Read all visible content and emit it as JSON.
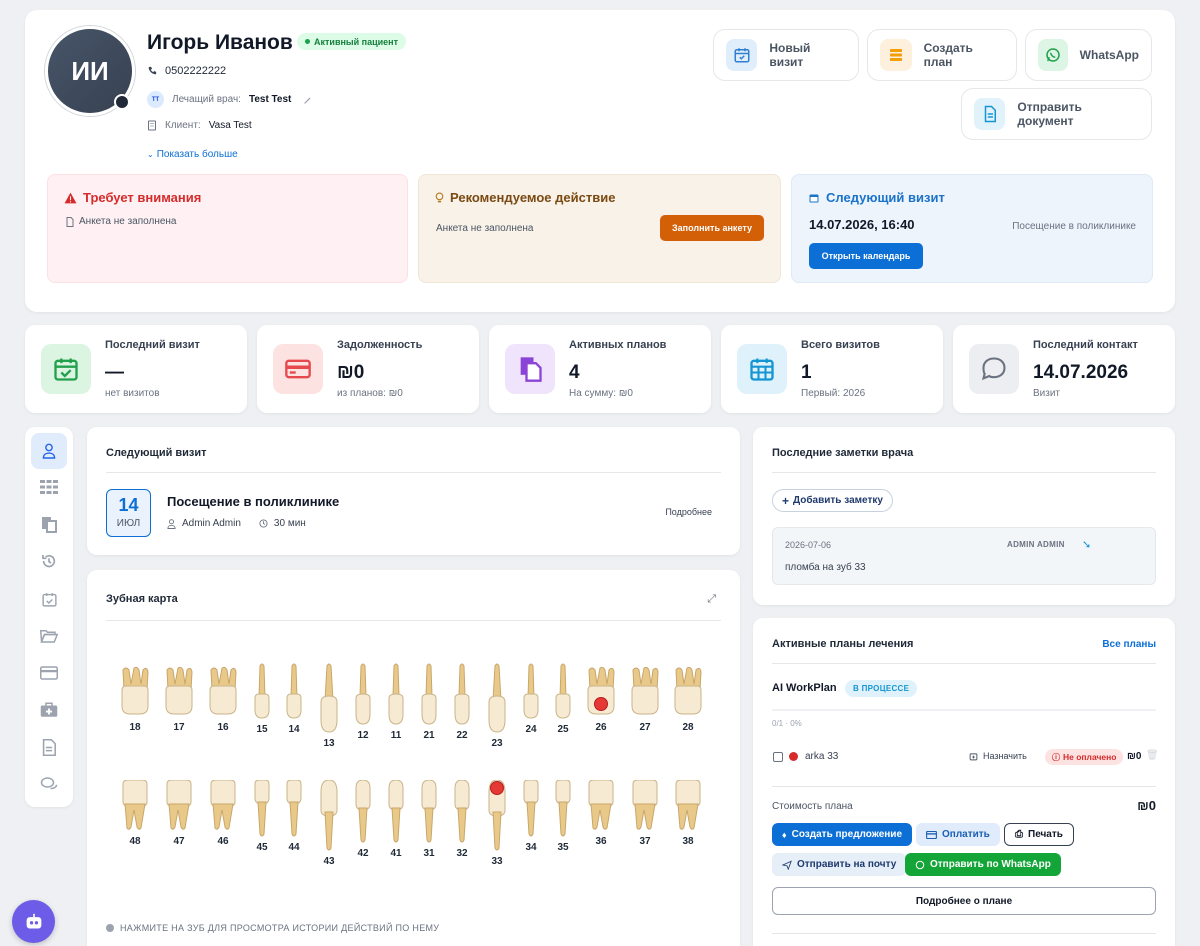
{
  "patient": {
    "initials": "ИИ",
    "name": "Игорь Иванов",
    "status": "Активный пациент",
    "phone": "0502222222",
    "doctor_label": "Лечащий врач:",
    "doctor": "Test Test",
    "doctor_badge": "ТТ",
    "client_label": "Клиент:",
    "client": "Vasa Test",
    "show_more": "Показать больше"
  },
  "actions": {
    "new_visit": "Новый визит",
    "create_plan": "Создать план",
    "whatsapp": "WhatsApp",
    "send_document": "Отправить документ"
  },
  "alerts": {
    "attention_title": "Требует внимания",
    "attention_item": "Анкета не заполнена",
    "recommended_title": "Рекомендуемое действие",
    "recommended_text": "Анкета не заполнена",
    "recommended_button": "Заполнить анкету",
    "next_title": "Следующий визит",
    "next_datetime": "14.07.2026, 16:40",
    "next_type": "Посещение в поликлинике",
    "next_button": "Открыть календарь"
  },
  "stats": [
    {
      "label": "Последний визит",
      "value": "—",
      "sub": "нет визитов",
      "icon": "calendar-check-icon",
      "bg": "#dcf5e3",
      "fg": "#22a04b"
    },
    {
      "label": "Задолженность",
      "value": "₪0",
      "sub": "из планов: ₪0",
      "icon": "credit-card-icon",
      "bg": "#fde2e2",
      "fg": "#e5484d"
    },
    {
      "label": "Активных планов",
      "value": "4",
      "sub": "На сумму: ₪0",
      "icon": "documents-icon",
      "bg": "#efe4fb",
      "fg": "#8b45d6"
    },
    {
      "label": "Всего визитов",
      "value": "1",
      "sub": "Первый: 2026",
      "icon": "calendar-grid-icon",
      "bg": "#dff2fb",
      "fg": "#1596d2"
    },
    {
      "label": "Последний контакт",
      "value": "14.07.2026",
      "sub": "Визит",
      "icon": "chat-bubble-icon",
      "bg": "#eceef2",
      "fg": "#6b7280"
    }
  ],
  "next_visit": {
    "title": "Следующий визит",
    "day": "14",
    "month": "ИЮЛ",
    "name": "Посещение в поликлинике",
    "doctor": "Admin Admin",
    "duration": "30 мин",
    "details": "Подробнее"
  },
  "dental": {
    "title": "Зубная карта",
    "hint": "НАЖМИТЕ НА ЗУБ ДЛЯ ПРОСМОТРА ИСТОРИИ ДЕЙСТВИЙ ПО НЕМУ",
    "upper": [
      "18",
      "17",
      "16",
      "15",
      "14",
      "13",
      "12",
      "11",
      "21",
      "22",
      "23",
      "24",
      "25",
      "26",
      "27",
      "28"
    ],
    "lower": [
      "48",
      "47",
      "46",
      "45",
      "44",
      "43",
      "42",
      "41",
      "31",
      "32",
      "33",
      "34",
      "35",
      "36",
      "37",
      "38"
    ],
    "marked": [
      "26",
      "33"
    ],
    "mark_color": "#e53935"
  },
  "notes": {
    "title": "Последние заметки врача",
    "add": "Добавить заметку",
    "items": [
      {
        "date": "2026-07-06",
        "author": "ADMIN ADMIN",
        "text": "пломба на зуб 33"
      }
    ]
  },
  "plans": {
    "title": "Активные планы лечения",
    "all": "Все планы",
    "plan_name": "AI WorkPlan",
    "plan_status": "В ПРОЦЕССЕ",
    "progress": "0/1 · 0%",
    "progress_value": 0,
    "item_name": "arka 33",
    "assign": "Назначить",
    "unpaid": "Не оплачено",
    "item_price": "₪0",
    "cost_label": "Стоимость плана",
    "cost": "₪0",
    "create_offer": "Создать предложение",
    "pay": "Оплатить",
    "print": "Печать",
    "send_mail": "Отправить на почту",
    "send_whatsapp": "Отправить по WhatsApp",
    "more": "Подробнее о плане"
  },
  "colors": {
    "primary": "#0b6fd6",
    "orange": "#d35f07",
    "green": "#13a538",
    "danger": "#d52b2b",
    "assistant": "#6d5ce8"
  }
}
